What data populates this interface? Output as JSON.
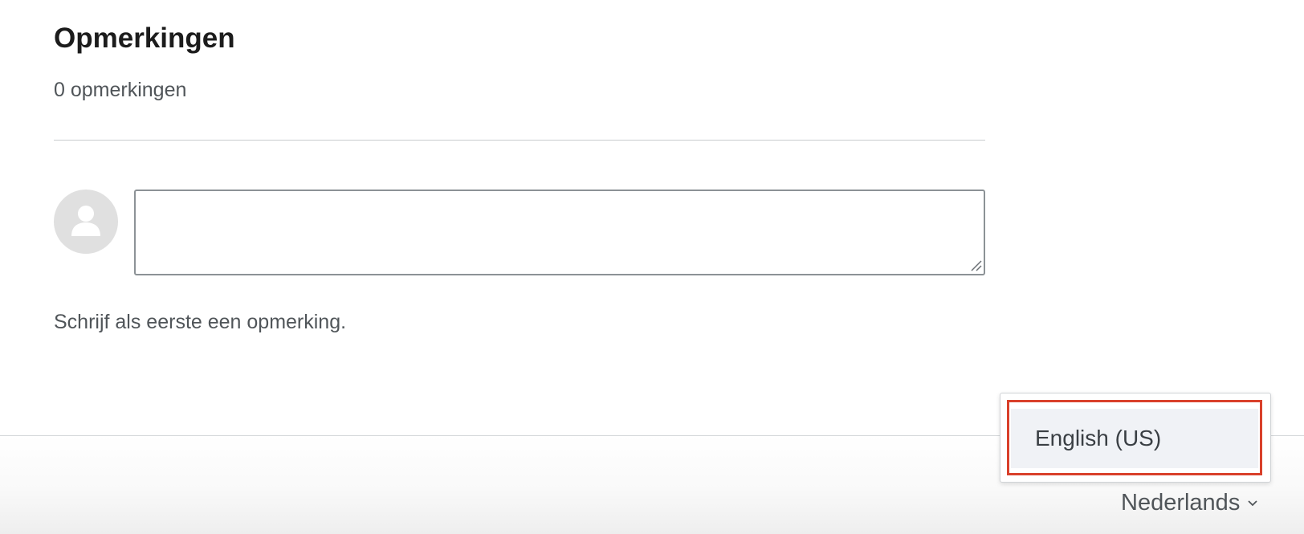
{
  "comments": {
    "title": "Opmerkingen",
    "count_text": "0 opmerkingen",
    "input": {
      "value": "",
      "placeholder": ""
    },
    "empty_text": "Schrijf als eerste een opmerking."
  },
  "footer": {
    "language_selector": {
      "current": "Nederlands",
      "options": [
        "English (US)"
      ],
      "expanded": true
    }
  },
  "icons": {
    "avatar": "user-avatar-icon",
    "chevron": "chevron-down-icon",
    "resize": "resize-handle-icon"
  },
  "colors": {
    "highlight_border": "#d9402b",
    "option_background": "#f0f2f6",
    "avatar_background": "#e0e0e0"
  }
}
